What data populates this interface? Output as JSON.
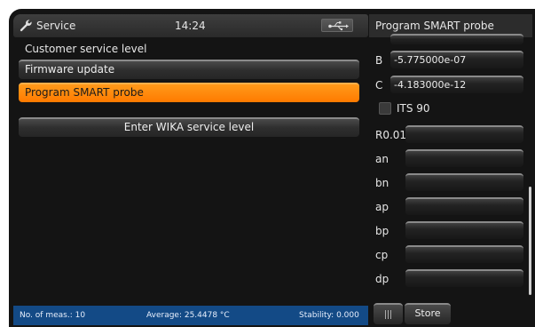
{
  "header": {
    "app_icon": "wrench-icon",
    "title": "Service",
    "time": "14:24",
    "usb_icon": "usb-icon"
  },
  "right_panel": {
    "title": "Program SMART probe",
    "params": [
      {
        "label": "B",
        "value": "-5.775000e-07"
      },
      {
        "label": "C",
        "value": "-4.183000e-12"
      }
    ],
    "its90": {
      "label": "ITS 90",
      "checked": false
    },
    "coefficients": [
      {
        "label": "R0.01",
        "value": ""
      },
      {
        "label": "an",
        "value": ""
      },
      {
        "label": "bn",
        "value": ""
      },
      {
        "label": "ap",
        "value": ""
      },
      {
        "label": "bp",
        "value": ""
      },
      {
        "label": "cp",
        "value": ""
      },
      {
        "label": "dp",
        "value": ""
      }
    ]
  },
  "menu": {
    "section_label": "Customer service level",
    "items": [
      {
        "label": "Firmware update",
        "active": false
      },
      {
        "label": "Program SMART probe",
        "active": true
      },
      {
        "label": "Enter WIKA service level",
        "active": false
      }
    ]
  },
  "status_bar": {
    "measurements": "No. of meas.: 10",
    "average": "Average: 25.4478 °C",
    "stability": "Stability: 0.000"
  },
  "actions": {
    "grip_icon": "grip-icon",
    "store_label": "Store"
  },
  "colors": {
    "accent": "#ff8000",
    "status_bar": "#134a86",
    "background": "#141414"
  }
}
